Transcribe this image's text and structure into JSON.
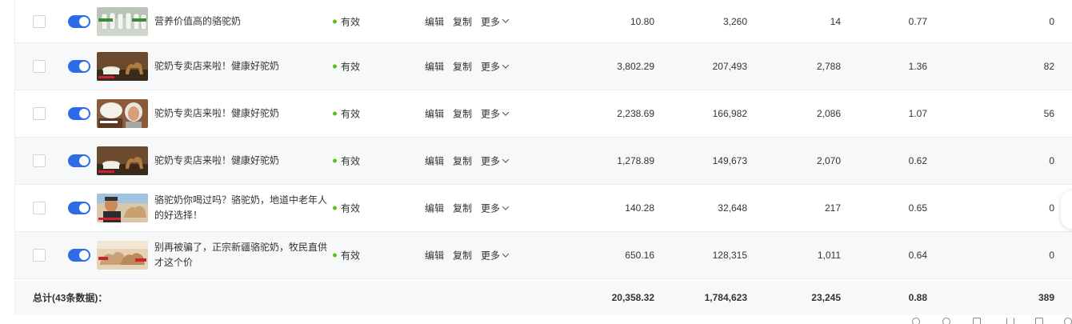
{
  "rows": [
    {
      "title": "营养价值高的骆驼奶",
      "status": "有效",
      "ops": {
        "edit": "编辑",
        "copy": "复制",
        "more": "更多"
      },
      "cost": "10.80",
      "impressions": "3,260",
      "clicks": "14",
      "rate": "0.77",
      "conv": "0",
      "thumb": "milk-bottles"
    },
    {
      "title": "驼奶专卖店来啦！健康好驼奶",
      "status": "有效",
      "ops": {
        "edit": "编辑",
        "copy": "复制",
        "more": "更多"
      },
      "cost": "3,802.29",
      "impressions": "207,493",
      "clicks": "2,788",
      "rate": "1.36",
      "conv": "82",
      "thumb": "camel-milk"
    },
    {
      "title": "驼奶专卖店来啦！健康好驼奶",
      "status": "有效",
      "ops": {
        "edit": "编辑",
        "copy": "复制",
        "more": "更多"
      },
      "cost": "2,238.69",
      "impressions": "166,982",
      "clicks": "2,086",
      "rate": "1.07",
      "conv": "56",
      "thumb": "old-woman"
    },
    {
      "title": "驼奶专卖店来啦！健康好驼奶",
      "status": "有效",
      "ops": {
        "edit": "编辑",
        "copy": "复制",
        "more": "更多"
      },
      "cost": "1,278.89",
      "impressions": "149,673",
      "clicks": "2,070",
      "rate": "0.62",
      "conv": "0",
      "thumb": "camel-milk"
    },
    {
      "title": "骆驼奶你喝过吗？骆驼奶，地道中老年人的好选择！",
      "status": "有效",
      "ops": {
        "edit": "编辑",
        "copy": "复制",
        "more": "更多"
      },
      "cost": "140.28",
      "impressions": "32,648",
      "clicks": "217",
      "rate": "0.65",
      "conv": "0",
      "thumb": "old-man"
    },
    {
      "title": "别再被骗了，正宗新疆骆驼奶，牧民直供才这个价",
      "status": "有效",
      "ops": {
        "edit": "编辑",
        "copy": "复制",
        "more": "更多"
      },
      "cost": "650.16",
      "impressions": "128,315",
      "clicks": "1,011",
      "rate": "0.64",
      "conv": "0",
      "thumb": "camels"
    }
  ],
  "total": {
    "label": "总计(43条数据)：",
    "cost": "20,358.32",
    "impressions": "1,784,623",
    "clicks": "23,245",
    "rate": "0.88",
    "conv": "389"
  },
  "colors": {
    "toggle_on": "#2e6be6",
    "status_ok": "#52c41a",
    "row_alt": "#f7f8fa"
  }
}
